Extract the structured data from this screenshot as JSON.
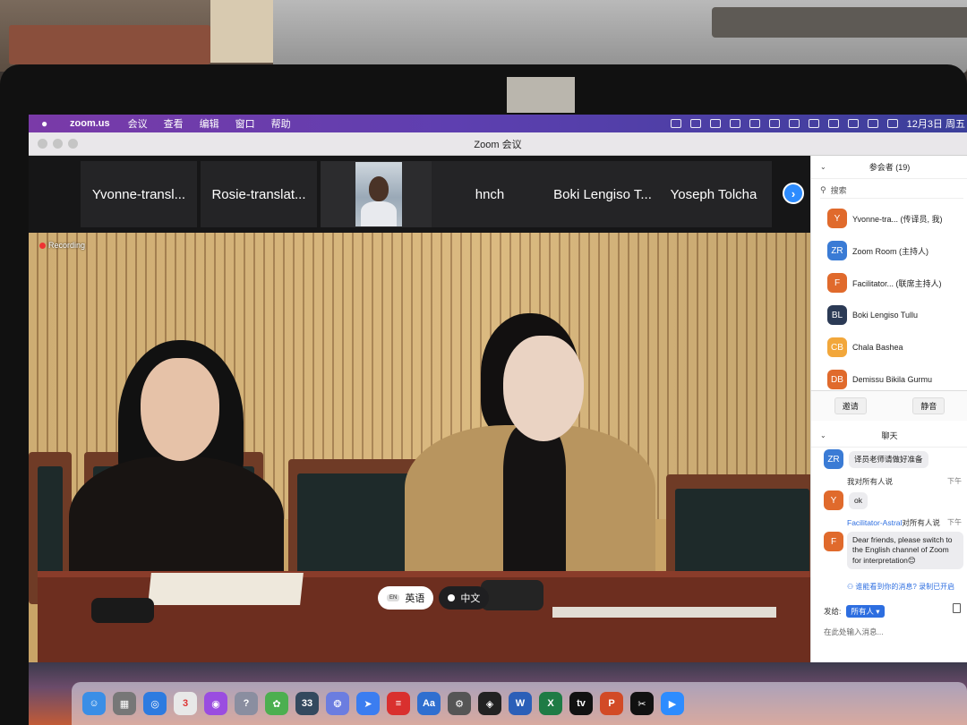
{
  "menubar": {
    "app_name": "zoom.us",
    "items": [
      "会议",
      "查看",
      "编辑",
      "窗口",
      "帮助"
    ],
    "clock": "12月3日 周五"
  },
  "window": {
    "title": "Zoom 会议"
  },
  "participants_strip": {
    "tiles": [
      "Yvonne-transl...",
      "Rosie-translat...",
      "hnch",
      "Boki Lengiso T...",
      "Yoseph Tolcha"
    ]
  },
  "video": {
    "recording_label": "Recording",
    "languages": {
      "english": "英语",
      "chinese": "中文",
      "english_badge": "EN"
    }
  },
  "panel": {
    "participants_title": "参会者 (19)",
    "search_placeholder": "搜索",
    "participants": [
      {
        "initials": "Y",
        "name": "Yvonne-tra... (传译员, 我)",
        "color": "#e06a2c"
      },
      {
        "initials": "ZR",
        "name": "Zoom Room (主持人)",
        "color": "#3a7bd5"
      },
      {
        "initials": "F",
        "name": "Facilitator... (联席主持人)",
        "color": "#e06a2c"
      },
      {
        "initials": "BL",
        "name": "Boki Lengiso Tullu",
        "color": "#2b3a55"
      },
      {
        "initials": "CB",
        "name": "Chala Bashea",
        "color": "#f2a73b"
      },
      {
        "initials": "DB",
        "name": "Demissu Bikila Gurmu",
        "color": "#e06a2c"
      }
    ],
    "invite_label": "邀请",
    "mute_label": "静音",
    "chat_title": "聊天",
    "chat": {
      "msg1_avatar": "ZR",
      "msg1_text": "译员老师请做好准备",
      "msg2_from": "我对所有人说",
      "msg2_time": "下午",
      "msg2_avatar": "Y",
      "msg2_text": "ok",
      "msg3_from_name": "Facilitator-Astral",
      "msg3_from_rest": "对所有人说",
      "msg3_time": "下午",
      "msg3_avatar": "F",
      "msg3_text": "Dear friends, please switch to the English channel of Zoom for interpretation😊",
      "seen_text": "谁能看到你的消息? 录制已开启",
      "sendto_label": "发给:",
      "sendto_value": "所有人",
      "input_placeholder": "在此处输入消息..."
    }
  },
  "dock": {
    "icons": [
      {
        "name": "finder-icon",
        "color": "#3a8ee6",
        "glyph": "☺"
      },
      {
        "name": "launchpad-icon",
        "color": "#777",
        "glyph": "▦"
      },
      {
        "name": "safari-icon",
        "color": "#2d7be0",
        "glyph": "◎"
      },
      {
        "name": "calendar-icon",
        "color": "#e8e8e8",
        "glyph": "3"
      },
      {
        "name": "podcasts-icon",
        "color": "#9a4de0",
        "glyph": "◉"
      },
      {
        "name": "help-icon",
        "color": "#8a8ea0",
        "glyph": "?"
      },
      {
        "name": "photos-icon",
        "color": "#4caf50",
        "glyph": "✿"
      },
      {
        "name": "badge-icon",
        "color": "#33495e",
        "glyph": "33"
      },
      {
        "name": "lark-icon",
        "color": "#6b7de0",
        "glyph": "❂"
      },
      {
        "name": "feishu-icon",
        "color": "#3b7df0",
        "glyph": "➤"
      },
      {
        "name": "wps-icon",
        "color": "#d9302e",
        "glyph": "≡"
      },
      {
        "name": "dictionary-icon",
        "color": "#2f6fd0",
        "glyph": "Aa"
      },
      {
        "name": "settings-icon",
        "color": "#555",
        "glyph": "⚙"
      },
      {
        "name": "app-icon",
        "color": "#222",
        "glyph": "◈"
      },
      {
        "name": "word-icon",
        "color": "#2b5fb8",
        "glyph": "W"
      },
      {
        "name": "excel-icon",
        "color": "#1e7b45",
        "glyph": "X"
      },
      {
        "name": "appletv-icon",
        "color": "#111",
        "glyph": "tv"
      },
      {
        "name": "powerpoint-icon",
        "color": "#d24a26",
        "glyph": "P"
      },
      {
        "name": "capcut-icon",
        "color": "#111",
        "glyph": "✂"
      },
      {
        "name": "zoom-icon",
        "color": "#2d8cff",
        "glyph": "▶"
      }
    ]
  }
}
